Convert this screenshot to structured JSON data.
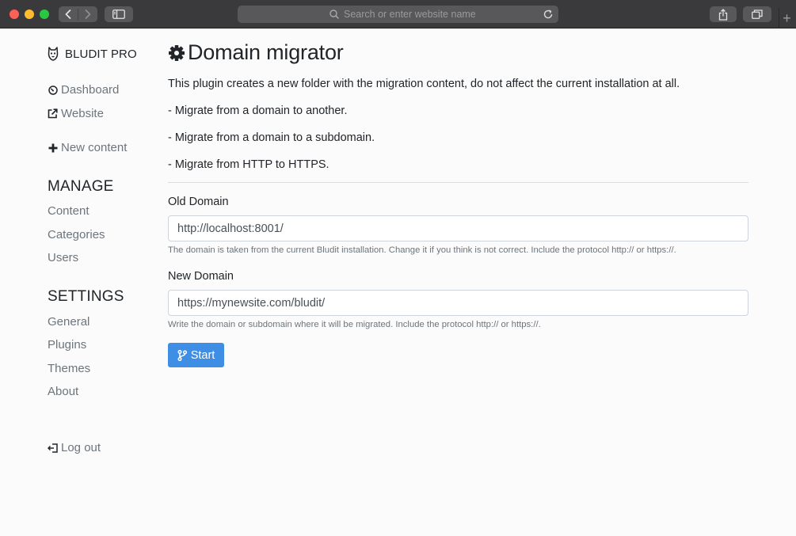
{
  "browser": {
    "address_placeholder": "Search or enter website name",
    "new_tab_symbol": "+"
  },
  "sidebar": {
    "brand": "BLUDIT PRO",
    "top_links": [
      {
        "label": "Dashboard",
        "icon": "dashboard-icon"
      },
      {
        "label": "Website",
        "icon": "external-link-icon"
      }
    ],
    "new_content": {
      "label": "New content",
      "icon": "plus-icon"
    },
    "manage": {
      "heading": "MANAGE",
      "items": [
        "Content",
        "Categories",
        "Users"
      ]
    },
    "settings": {
      "heading": "SETTINGS",
      "items": [
        "General",
        "Plugins",
        "Themes",
        "About"
      ]
    },
    "logout": {
      "label": "Log out",
      "icon": "sign-out-icon"
    }
  },
  "main": {
    "title": "Domain migrator",
    "title_icon": "gear-icon",
    "description": "This plugin creates a new folder with the migration content, do not affect the current installation at all.",
    "bullets": [
      "- Migrate from a domain to another.",
      "- Migrate from a domain to a subdomain.",
      "- Migrate from HTTP to HTTPS."
    ],
    "old_domain": {
      "label": "Old Domain",
      "value": "http://localhost:8001/",
      "help": "The domain is taken from the current Bludit installation. Change it if you think is not correct. Include the protocol http:// or https://."
    },
    "new_domain": {
      "label": "New Domain",
      "value": "https://mynewsite.com/bludit/",
      "help": "Write the domain or subdomain where it will be migrated. Include the protocol http:// or https://."
    },
    "start_button": {
      "label": "Start",
      "icon": "code-branch-icon"
    }
  },
  "colors": {
    "primary": "#3f8ee5",
    "text": "#212529",
    "muted": "#6c757d",
    "background": "#fbfbfb"
  }
}
